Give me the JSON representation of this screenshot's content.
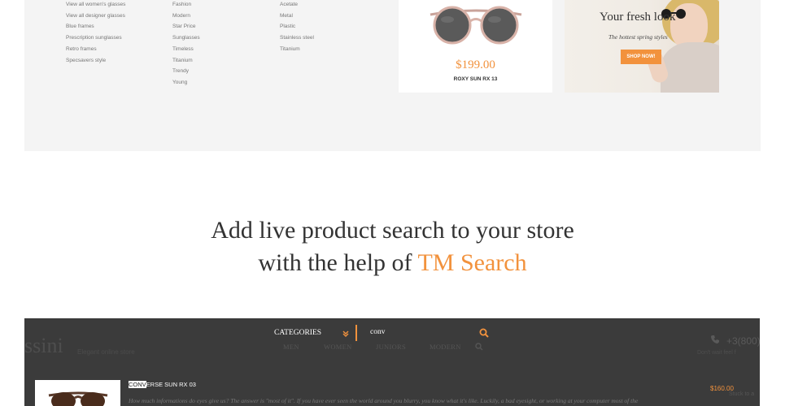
{
  "menu": {
    "column_1": [
      "View all women's glasses",
      "View all designer glasses",
      "Blue frames",
      "Prescription sunglasses",
      "Retro frames",
      "Specsavers style"
    ],
    "column_2": [
      "Fashion",
      "Modern",
      "Star Price",
      "Sunglasses",
      "Timeless",
      "Titanium",
      "Trendy",
      "Young"
    ],
    "column_3": [
      "Acetate",
      "Metal",
      "Plastic",
      "Stainless steel",
      "Titanium"
    ]
  },
  "product": {
    "price": "$199.00",
    "name": "ROXY SUN RX 13"
  },
  "promo": {
    "title": "Your fresh look",
    "subtitle": "The hottest spring styles",
    "button": "SHOP NOW!"
  },
  "headline": {
    "line1": "Add live product search to your store",
    "line2_prefix": "with the help of ",
    "line2_accent": "TM Search"
  },
  "demo": {
    "logo": "ssini",
    "tagline": "Elegant online store",
    "phone": "+3(800)",
    "hours": "Don't wait feel f",
    "nav": [
      "MEN",
      "WOMEN",
      "JUNIORS",
      "MODERN"
    ],
    "search": {
      "categories_label": "CATEGORIES",
      "query": "conv"
    },
    "result": {
      "title_match": "CONV",
      "title_rest": "ERSE SUN RX 03",
      "price": "$160.00",
      "description": "How much informations do eyes give us? The answer is \"most of it\". If you have ever seen the world around you blurry, you know what it's like. Luckily, a bad eyesight, or working at your computer most of the",
      "side_text": "Stuck to a"
    }
  },
  "colors": {
    "accent": "#f2923d",
    "panel": "#f4f4f4",
    "dark": "#3b3b3b"
  }
}
